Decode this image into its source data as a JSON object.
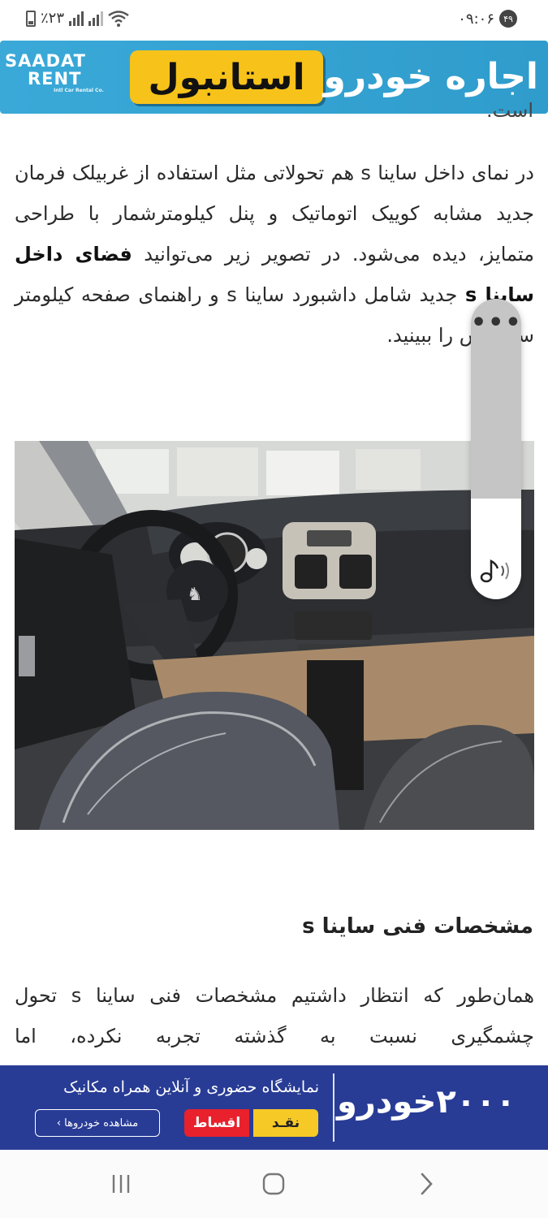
{
  "status_bar": {
    "battery": "٪۲۳",
    "time": "۰۹:۰۶",
    "notification_count": "۴۹"
  },
  "top_ad": {
    "brand_line1": "SAADAT",
    "brand_line2": "RENT",
    "brand_tagline": "Intl Car Rental Co.",
    "city": "استانبول",
    "title": "اجاره خودرو"
  },
  "article": {
    "clipped_top_line": "است.",
    "paragraph1_before": "در نمای داخل ساینا s هم تحولاتی مثل استفاده از غربیلک فرمان جدید مشابه کوییک اتوماتیک و پنل کیلومترشمار با طراحی متمایز، دیده می‌شود. در تصویر زیر می‌توانید ",
    "paragraph1_bold": "فضای داخل ساینا s",
    "paragraph1_after": " جدید شامل داشبورد ساینا s و راهنمای صفحه کیلومتر ساینا اس را ببینید.",
    "heading": "مشخصات فنی ساینا s",
    "paragraph2": "همان‌طور که انتظار داشتیم مشخصات فنی ساینا s تحول چشمگیری نسبت به گذشته تجربه نکرده، اما"
  },
  "volume_panel": {
    "more_label": "•••",
    "icon": "music-note-volume-icon",
    "level_fraction": 0.33
  },
  "bottom_ad": {
    "brand": "۲۰۰۰خودرو",
    "subtitle": "نمایشگاه حضوری و آنلاین همراه مکانیک",
    "view_button": "مشاهده خودروها ›",
    "installment_button": "اقساط",
    "cash_button": "نقـد"
  },
  "nav_bar": {
    "recents_icon": "recents-icon",
    "home_icon": "home-icon",
    "back_icon": "back-icon"
  }
}
